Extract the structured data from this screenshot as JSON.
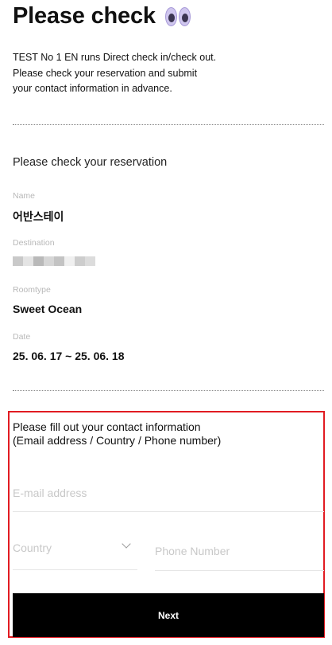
{
  "header": {
    "title": "Please check",
    "emoji_icon": "eyes-icon"
  },
  "intro": {
    "line1": "TEST No 1 EN runs Direct check in/check out.",
    "line2": "Please check your reservation and submit",
    "line3": "your contact information in advance."
  },
  "reservation": {
    "heading": "Please check your reservation",
    "name_label": "Name",
    "name_value": "어반스테이",
    "destination_label": "Destination",
    "roomtype_label": "Roomtype",
    "roomtype_value": "Sweet Ocean",
    "date_label": "Date",
    "date_value": "25. 06. 17 ~ 25. 06. 18"
  },
  "contact": {
    "heading_line1": "Please fill out your contact information",
    "heading_line2": "(Email address / Country / Phone number)",
    "email_placeholder": "E-mail address",
    "country_placeholder": "Country",
    "phone_placeholder": "Phone Number",
    "highlight_color": "#e11b22"
  },
  "actions": {
    "next_label": "Next"
  }
}
